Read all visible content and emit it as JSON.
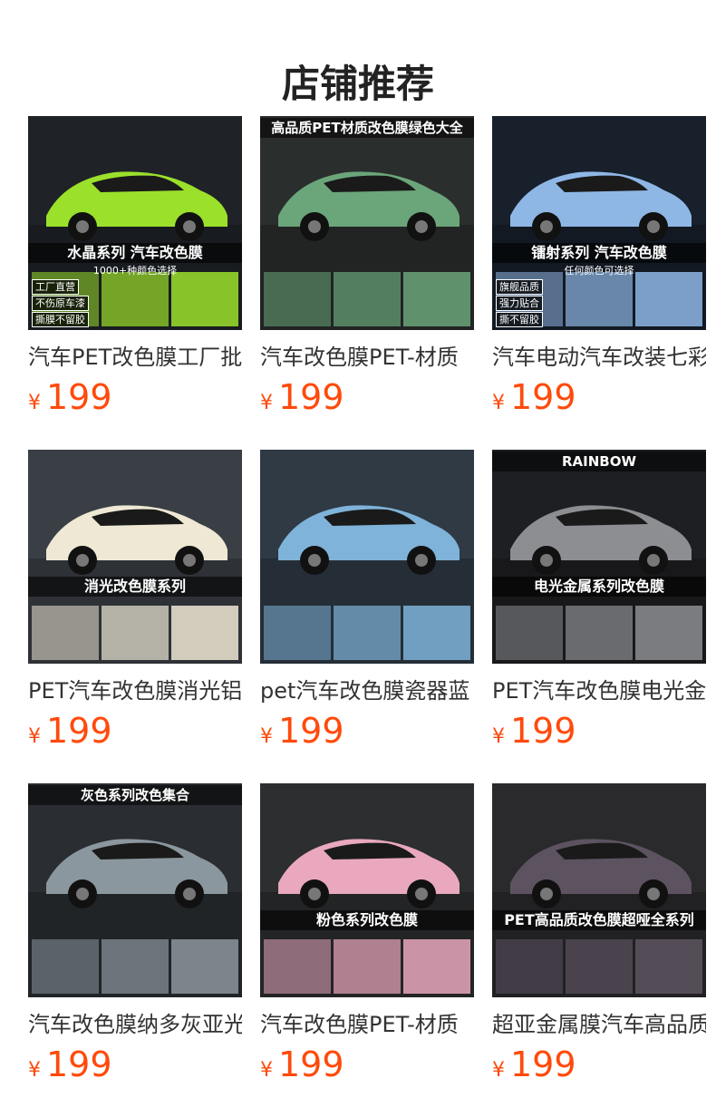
{
  "header": {
    "title": "店铺推荐"
  },
  "colors": {
    "price": "#ff4a0b",
    "title_text": "#333333",
    "heading_text": "#222222"
  },
  "products": [
    {
      "title": "汽车PET改色膜工厂批",
      "currency": "¥",
      "price": "199",
      "thumb": {
        "top_text": "",
        "mid_text": "水晶系列 汽车改色膜",
        "sub_text": "1000+种颜色选择",
        "badges": [
          "工厂直营",
          "不伤原车漆",
          "撕膜不留胶"
        ],
        "accent": "#9be02b",
        "bg": "#1f2328"
      }
    },
    {
      "title": "汽车改色膜PET-材质",
      "currency": "¥",
      "price": "199",
      "thumb": {
        "top_text": "高品质PET材质改色膜绿色大全",
        "mid_text": "",
        "sub_text": "",
        "badges": [],
        "accent": "#6ba57a",
        "bg": "#2a2e2c"
      }
    },
    {
      "title": "汽车电动汽车改装七彩",
      "currency": "¥",
      "price": "199",
      "thumb": {
        "top_text": "",
        "mid_text": "镭射系列 汽车改色膜",
        "sub_text": "任何颜色可选择",
        "badges": [
          "旗舰品质",
          "强力贴合",
          "撕不留胶"
        ],
        "accent": "#8fb7e6",
        "bg": "#17202b"
      }
    },
    {
      "title": "PET汽车改色膜消光铝",
      "currency": "¥",
      "price": "199",
      "thumb": {
        "top_text": "",
        "mid_text": "消光改色膜系列",
        "sub_text": "",
        "badges": [],
        "accent": "#eee8d5",
        "bg": "#3a3f45"
      }
    },
    {
      "title": "pet汽车改色膜瓷器蓝",
      "currency": "¥",
      "price": "199",
      "thumb": {
        "top_text": "",
        "mid_text": "",
        "sub_text": "",
        "badges": [],
        "accent": "#7fb3d9",
        "bg": "#2f3a45"
      }
    },
    {
      "title": "PET汽车改色膜电光金",
      "currency": "¥",
      "price": "199",
      "thumb": {
        "top_text": "RAINBOW",
        "mid_text": "电光金属系列改色膜",
        "sub_text": "",
        "badges": [],
        "accent": "#8c8e92",
        "bg": "#1e1f22"
      }
    },
    {
      "title": "汽车改色膜纳多灰亚光",
      "currency": "¥",
      "price": "199",
      "thumb": {
        "top_text": "灰色系列改色集合",
        "mid_text": "",
        "sub_text": "",
        "badges": [],
        "accent": "#8b979e",
        "bg": "#2a2d31"
      }
    },
    {
      "title": "汽车改色膜PET-材质",
      "currency": "¥",
      "price": "199",
      "thumb": {
        "top_text": "",
        "mid_text": "粉色系列改色膜",
        "sub_text": "",
        "badges": [],
        "accent": "#e9a8bd",
        "bg": "#2c2e30"
      }
    },
    {
      "title": "超亚金属膜汽车高品质",
      "currency": "¥",
      "price": "199",
      "thumb": {
        "top_text": "",
        "mid_text": "PET高品质改色膜超哑全系列",
        "sub_text": "",
        "badges": [],
        "accent": "#5d5360",
        "bg": "#2a2a2d"
      }
    }
  ]
}
